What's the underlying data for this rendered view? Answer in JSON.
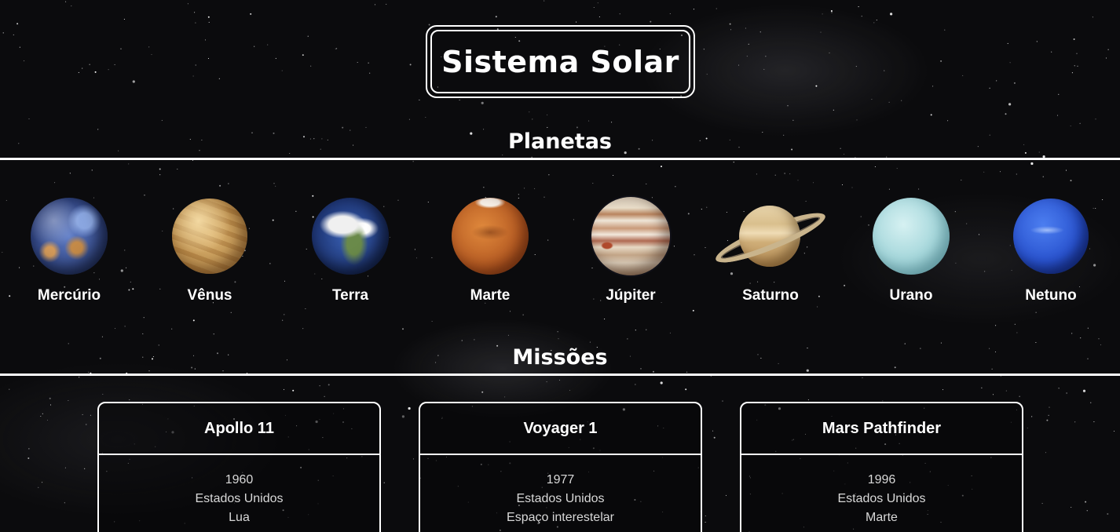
{
  "site": {
    "title": "Sistema Solar"
  },
  "sections": {
    "planets_title": "Planetas",
    "missions_title": "Missões"
  },
  "planets": [
    {
      "name": "Mercúrio",
      "image": "mercury-planet"
    },
    {
      "name": "Vênus",
      "image": "venus-planet"
    },
    {
      "name": "Terra",
      "image": "earth-planet"
    },
    {
      "name": "Marte",
      "image": "mars-planet"
    },
    {
      "name": "Júpiter",
      "image": "jupiter-planet"
    },
    {
      "name": "Saturno",
      "image": "saturn-planet"
    },
    {
      "name": "Urano",
      "image": "uranus-planet"
    },
    {
      "name": "Netuno",
      "image": "neptune-planet"
    }
  ],
  "missions": [
    {
      "name": "Apollo 11",
      "year": "1960",
      "country": "Estados Unidos",
      "destination": "Lua"
    },
    {
      "name": "Voyager 1",
      "year": "1977",
      "country": "Estados Unidos",
      "destination": "Espaço interestelar"
    },
    {
      "name": "Mars Pathfinder",
      "year": "1996",
      "country": "Estados Unidos",
      "destination": "Marte"
    }
  ],
  "colors": {
    "background": "#0b0b0d",
    "foreground": "#ffffff",
    "muted_text": "#d8d8d8"
  }
}
